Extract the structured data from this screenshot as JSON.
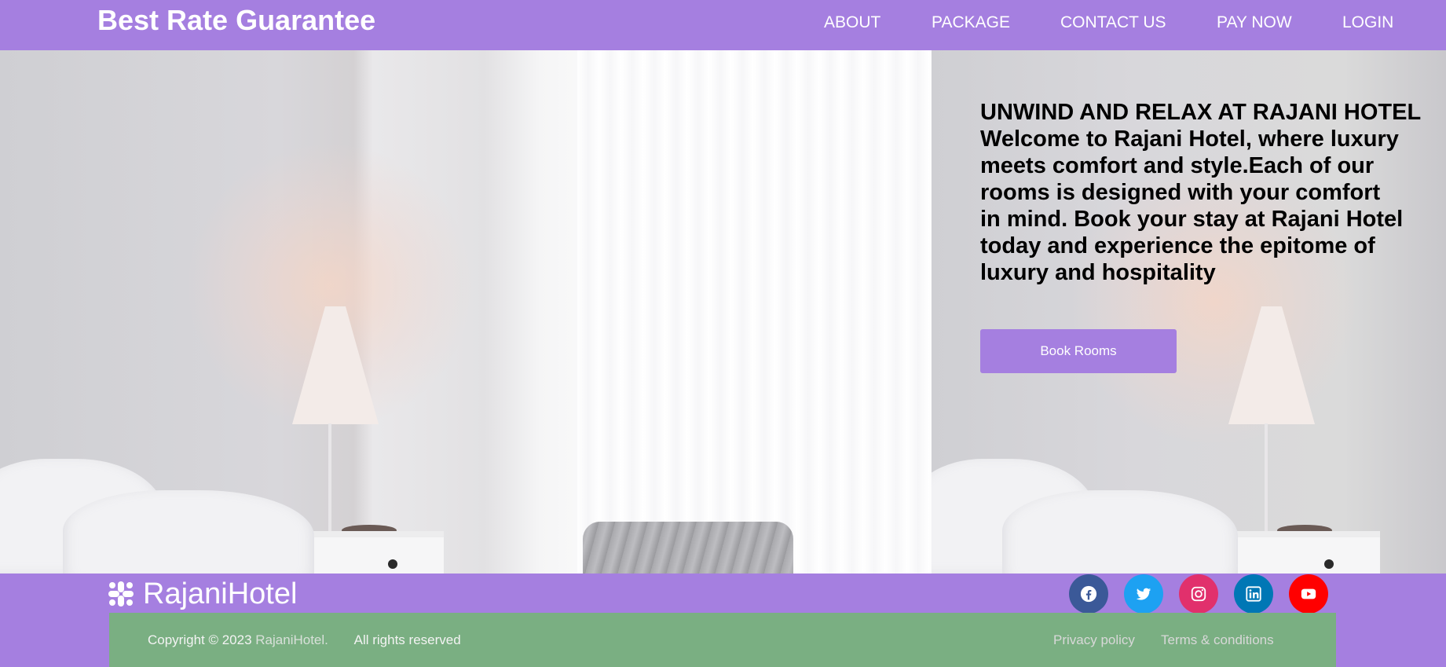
{
  "header": {
    "brand": "Best Rate Guarantee",
    "nav": [
      "ABOUT",
      "PACKAGE",
      "CONTACT US",
      "PAY NOW",
      "LOGIN"
    ]
  },
  "hero": {
    "title": "UNWIND AND RELAX AT RAJANI HOTEL",
    "body": "Welcome to Rajani Hotel, where luxury meets comfort and style.Each of our rooms is designed with your comfort in mind. Book your stay at Rajani Hotel today and experience the epitome of luxury and hospitality",
    "button": "Book Rooms",
    "image": "hotel bedroom with lamp, nightstand, curtain and suitcase"
  },
  "footer": {
    "logo_text": "RajaniHotel",
    "logo_icon": "slack-like-logo-icon",
    "social": [
      "facebook-icon",
      "twitter-icon",
      "instagram-icon",
      "linkedin-icon",
      "youtube-icon"
    ],
    "copyright_prefix": "Copyright © 2023",
    "copyright_site": "RajaniHotel.",
    "rights": "All rights reserved",
    "privacy": "Privacy policy",
    "terms": "Terms & conditions"
  },
  "colors": {
    "accent": "#a57fe0",
    "copy_bar": "#7aaf82",
    "facebook": "#3b5998",
    "twitter": "#1da1f2",
    "instagram": "#e1306c",
    "linkedin": "#0077b5",
    "youtube": "#ff0000"
  }
}
